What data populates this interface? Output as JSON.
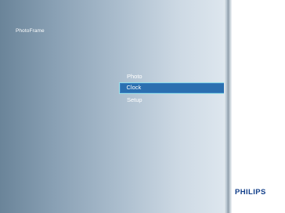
{
  "app": {
    "title": "PhotoFrame",
    "brand": "PHILIPS"
  },
  "menu": {
    "items": [
      {
        "label": "Photo",
        "selected": false
      },
      {
        "label": "Clock",
        "selected": true
      },
      {
        "label": "Setup",
        "selected": false
      }
    ]
  },
  "colors": {
    "selection_fill": "#2b6fb0",
    "selection_border": "#9fe0e6",
    "brand": "#123f8a"
  }
}
